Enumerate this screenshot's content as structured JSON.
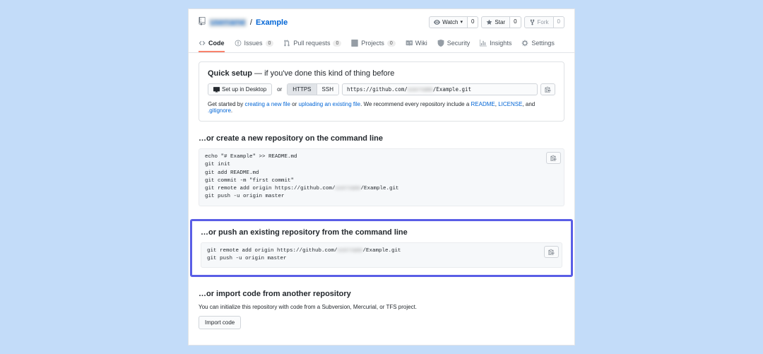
{
  "repo": {
    "owner_hidden": "username",
    "name": "Example",
    "separator": "/"
  },
  "actions": {
    "watch": {
      "label": "Watch",
      "count": "0"
    },
    "star": {
      "label": "Star",
      "count": "0"
    },
    "fork": {
      "label": "Fork",
      "count": "0"
    }
  },
  "tabs": {
    "code": "Code",
    "issues": {
      "label": "Issues",
      "count": "0"
    },
    "pulls": {
      "label": "Pull requests",
      "count": "0"
    },
    "projects": {
      "label": "Projects",
      "count": "0"
    },
    "wiki": "Wiki",
    "security": "Security",
    "insights": "Insights",
    "settings": "Settings"
  },
  "setup": {
    "title_strong": "Quick setup",
    "title_rest": " — if you've done this kind of thing before",
    "desktop_btn": "Set up in Desktop",
    "or": "or",
    "https": "HTTPS",
    "ssh": "SSH",
    "url_prefix": "https://github.com/",
    "url_blur": "username",
    "url_suffix": "/Example.git",
    "help_1": "Get started by ",
    "help_link1": "creating a new file",
    "help_or": " or ",
    "help_link2": "uploading an existing file",
    "help_2": ". We recommend every repository include a ",
    "help_link3": "README",
    "help_comma": ", ",
    "help_link4": "LICENSE",
    "help_and": ", and ",
    "help_link5": ".gitignore",
    "help_end": "."
  },
  "section_create": {
    "title": "…or create a new repository on the command line",
    "line1": "echo \"# Example\" >> README.md",
    "line2": "git init",
    "line3": "git add README.md",
    "line4": "git commit -m \"first commit\"",
    "line5_pre": "git remote add origin https://github.com/",
    "line5_blur": "username",
    "line5_post": "/Example.git",
    "line6": "git push -u origin master"
  },
  "section_push": {
    "title": "…or push an existing repository from the command line",
    "line1_pre": "git remote add origin https://github.com/",
    "line1_blur": "username",
    "line1_post": "/Example.git",
    "line2": "git push -u origin master"
  },
  "section_import": {
    "title": "…or import code from another repository",
    "text": "You can initialize this repository with code from a Subversion, Mercurial, or TFS project.",
    "button": "Import code"
  }
}
